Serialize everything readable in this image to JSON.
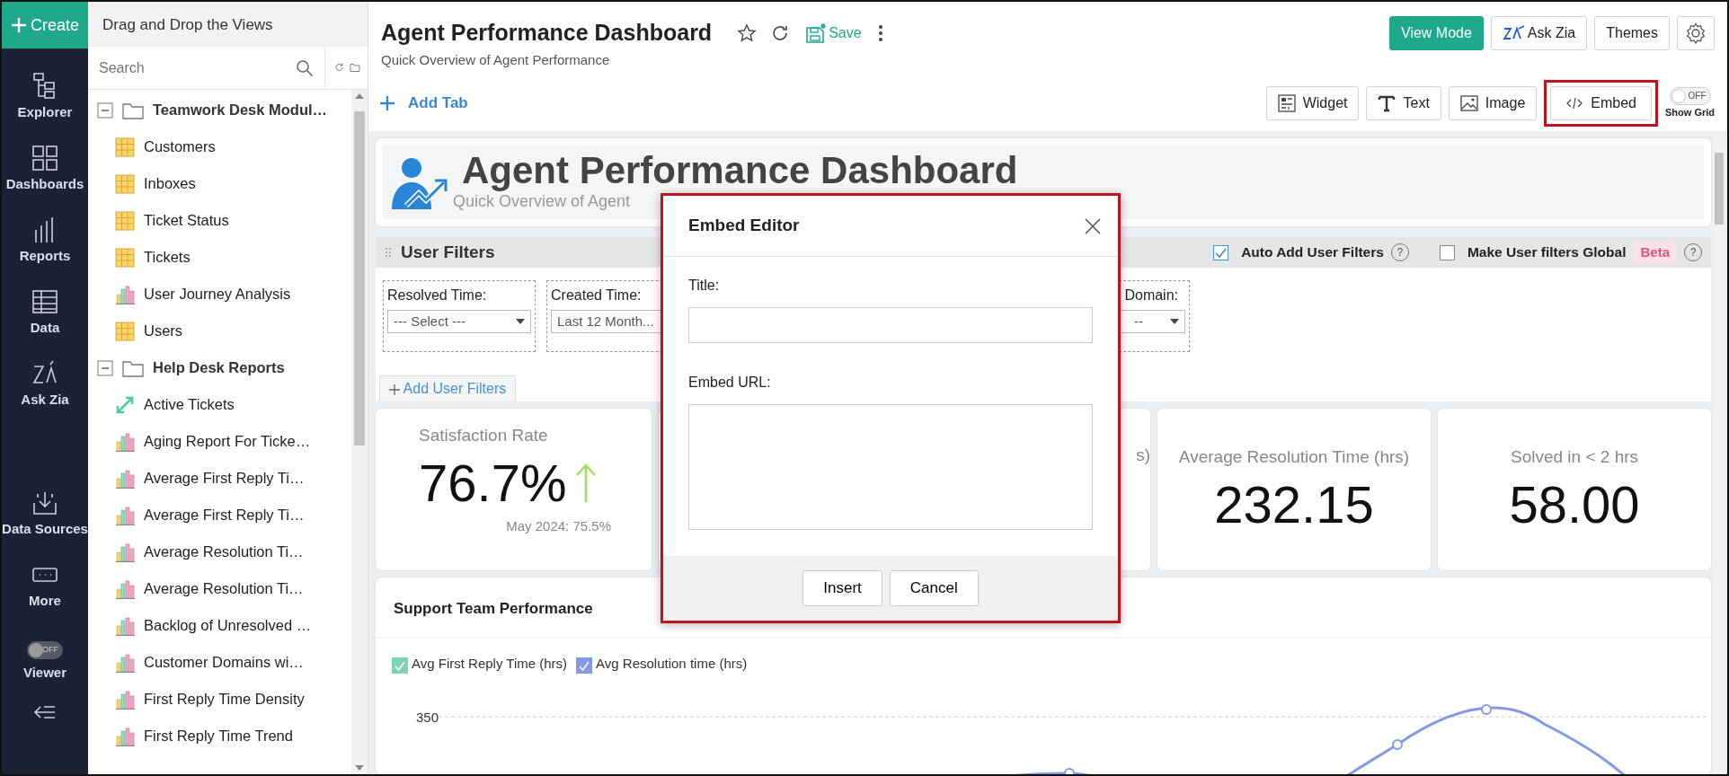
{
  "nav": {
    "create": "Create",
    "items": [
      {
        "label": "Explorer",
        "kind": "explorer"
      },
      {
        "label": "Dashboards",
        "kind": "dashboards"
      },
      {
        "label": "Reports",
        "kind": "reports"
      },
      {
        "label": "Data",
        "kind": "data"
      },
      {
        "label": "Ask Zia",
        "kind": "zia"
      },
      {
        "label": "Data Sources",
        "kind": "sources"
      },
      {
        "label": "More",
        "kind": "more"
      }
    ],
    "viewer": {
      "label": "Viewer",
      "toggle_text": "OFF",
      "on": false
    }
  },
  "explorer": {
    "header": "Drag and Drop the Views",
    "search": {
      "placeholder": "Search"
    },
    "tree": [
      {
        "label": "Teamwork Desk Modul…",
        "kind": "folder",
        "expanded": true,
        "children": [
          {
            "label": "Customers",
            "kind": "table"
          },
          {
            "label": "Inboxes",
            "kind": "table"
          },
          {
            "label": "Ticket Status",
            "kind": "table"
          },
          {
            "label": "Tickets",
            "kind": "table"
          },
          {
            "label": "User Journey Analysis",
            "kind": "chart"
          },
          {
            "label": "Users",
            "kind": "table"
          }
        ]
      },
      {
        "label": "Help Desk Reports",
        "kind": "folder",
        "expanded": true,
        "children": [
          {
            "label": "Active Tickets",
            "kind": "kpi"
          },
          {
            "label": "Aging Report For Ticke…",
            "kind": "chart"
          },
          {
            "label": "Average First Reply Ti…",
            "kind": "chart"
          },
          {
            "label": "Average First Reply Ti…",
            "kind": "chart"
          },
          {
            "label": "Average Resolution Ti…",
            "kind": "chart"
          },
          {
            "label": "Average Resolution Ti…",
            "kind": "chart"
          },
          {
            "label": "Backlog of Unresolved …",
            "kind": "chart"
          },
          {
            "label": "Customer Domains wi…",
            "kind": "chart"
          },
          {
            "label": "First Reply Time Density",
            "kind": "chart"
          },
          {
            "label": "First Reply Time Trend",
            "kind": "chart"
          }
        ]
      }
    ]
  },
  "header": {
    "title": "Agent Performance Dashboard",
    "subtitle": "Quick Overview of Agent Performance",
    "save": "Save",
    "actions": [
      {
        "label": "View Mode",
        "kind": "primary"
      },
      {
        "label": "Ask Zia",
        "kind": "zia"
      },
      {
        "label": "Themes",
        "kind": "plain"
      }
    ]
  },
  "add_tab": "Add Tab",
  "toolbar": {
    "items": [
      {
        "label": "Widget",
        "kind": "widget",
        "highlighted": false
      },
      {
        "label": "Text",
        "kind": "text",
        "highlighted": false
      },
      {
        "label": "Image",
        "kind": "image",
        "highlighted": false
      },
      {
        "label": "Embed",
        "kind": "embed",
        "highlighted": true
      }
    ],
    "grid_toggle": {
      "text": "OFF",
      "label": "Show Grid",
      "on": false
    }
  },
  "banner": {
    "title": "Agent Performance Dashboard",
    "subtitle": "Quick Overview of Agent"
  },
  "user_filters": {
    "title": "User Filters",
    "options": [
      {
        "label": "Auto Add User Filters",
        "checked": true,
        "help": "?"
      },
      {
        "label": "Make User filters Global",
        "checked": false,
        "badge": "Beta",
        "help": "?"
      }
    ],
    "filters": [
      {
        "label": "Resolved Time:",
        "value": "--- Select ---",
        "kind": "full"
      },
      {
        "label": "Created Time:",
        "value": "Last 12 Month...",
        "kind": "full"
      },
      {
        "label": "Domain:",
        "value": "--",
        "kind": "cut"
      }
    ],
    "add": "Add User Filters"
  },
  "kpis": [
    {
      "kind": "trend",
      "title": "Satisfaction Rate",
      "value": "76.7%",
      "note": "May 2024: 75.5%"
    },
    {
      "kind": "cut",
      "title": "s)"
    },
    {
      "kind": "plain",
      "title": "Average Resolution Time (hrs)",
      "value": "232.15"
    },
    {
      "kind": "plain",
      "title": "Solved in < 2 hrs",
      "value": "58.00"
    }
  ],
  "chart": {
    "title": "Support Team Performance",
    "legend": [
      {
        "label": "Avg First Reply Time (hrs)",
        "color": "#7dd3b5",
        "checked": true
      },
      {
        "label": "Avg Resolution time (hrs)",
        "color": "#8599e2",
        "checked": true
      }
    ],
    "ytick_label": "350"
  },
  "dialog": {
    "title": "Embed Editor",
    "fields": [
      {
        "label": "Title:",
        "kind": "input"
      },
      {
        "label": "Embed URL:",
        "kind": "textarea"
      }
    ],
    "buttons": [
      "Insert",
      "Cancel"
    ],
    "highlighted": true
  }
}
